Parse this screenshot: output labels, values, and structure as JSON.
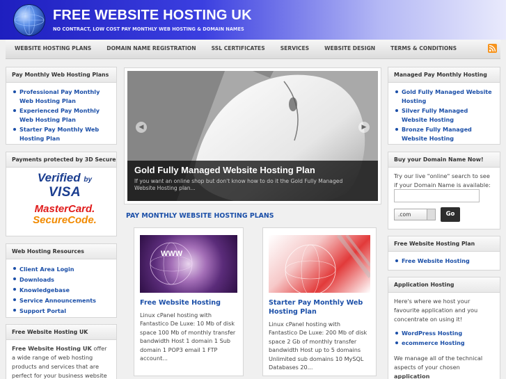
{
  "header": {
    "title": "FREE WEBSITE HOSTING UK",
    "tagline": "NO CONTRACT, LOW COST PAY MONTHLY WEB HOSTING & DOMAIN NAMES",
    "logo_icon": "globe-icon"
  },
  "nav": {
    "items": [
      "WEBSITE HOSTING PLANS",
      "DOMAIN NAME REGISTRATION",
      "SSL CERTIFICATES",
      "SERVICES",
      "WEBSITE DESIGN",
      "TERMS & CONDITIONS"
    ],
    "rss_icon": "rss-icon"
  },
  "left": {
    "plans": {
      "title": "Pay Monthly Web Hosting Plans",
      "items": [
        "Professional Pay Monthly Web Hosting Plan",
        "Experienced Pay Monthly Web Hosting Plan",
        "Starter Pay Monthly Web Hosting Plan"
      ]
    },
    "secure": {
      "title": "Payments protected by 3D Secure",
      "verified_line1": "Verified",
      "verified_by": "by",
      "verified_line2": "VISA",
      "mastercard_line1": "MasterCard.",
      "mastercard_line2": "SecureCode."
    },
    "resources": {
      "title": "Web Hosting Resources",
      "items": [
        "Client Area Login",
        "Downloads",
        "Knowledgebase",
        "Service Announcements",
        "Support Portal"
      ]
    },
    "about": {
      "title": "Free Website Hosting UK",
      "bold": "Free Website Hosting UK",
      "text": " offer a wide range of web hosting products and services that are perfect for your business website hosting."
    }
  },
  "slider": {
    "caption_title": "Gold Fully Managed Website Hosting Plan",
    "caption_text": "If you want an online shop but don't know how to do it the Gold Fully Managed Website Hosting plan...",
    "prev_icon": "chevron-left-icon",
    "next_icon": "chevron-right-icon"
  },
  "main": {
    "section_heading": "PAY MONTHLY WEBSITE HOSTING PLANS",
    "cards": [
      {
        "title": "Free Website Hosting",
        "desc": "Linux cPanel hosting with Fantastico De Luxe: 10 Mb of disk space 100 Mb of monthly transfer bandwidth Host 1 domain 1 Sub domain 1 POP3 email 1 FTP account...",
        "thumb_text": "WWW"
      },
      {
        "title": "Starter Pay Monthly Web Hosting Plan",
        "desc": "Linux cPanel hosting with Fantastico De Luxe: 200 Mb of disk space 2 Gb of monthly transfer bandwidth Host up to 5 domains Unlimited sub domains 10 MySQL Databases 20..."
      }
    ]
  },
  "right": {
    "managed": {
      "title": "Managed Pay Monthly Hosting",
      "items": [
        "Gold Fully Managed Website Hosting",
        "Silver Fully Managed Website Hosting",
        "Bronze Fully Managed Website Hosting"
      ]
    },
    "domain": {
      "title": "Buy your Domain Name Now!",
      "text": "Try our live \"online\" search to see if your Domain Name is available:",
      "input_value": "",
      "tld": ".com",
      "go_label": "Go"
    },
    "free_plan": {
      "title": "Free Website Hosting Plan",
      "items": [
        "Free Website Hosting"
      ]
    },
    "app": {
      "title": "Application Hosting",
      "text": "Here's where we host your favourite application and you concentrate on using it!",
      "items": [
        "WordPress Hosting",
        "ecommerce Hosting"
      ],
      "text2_start": "We manage all of the technical aspects of your chosen ",
      "text2_bold": "application"
    }
  },
  "colors": {
    "link": "#1b4fa8",
    "header_start": "#1e1fbf",
    "header_end": "#e9eafc"
  }
}
